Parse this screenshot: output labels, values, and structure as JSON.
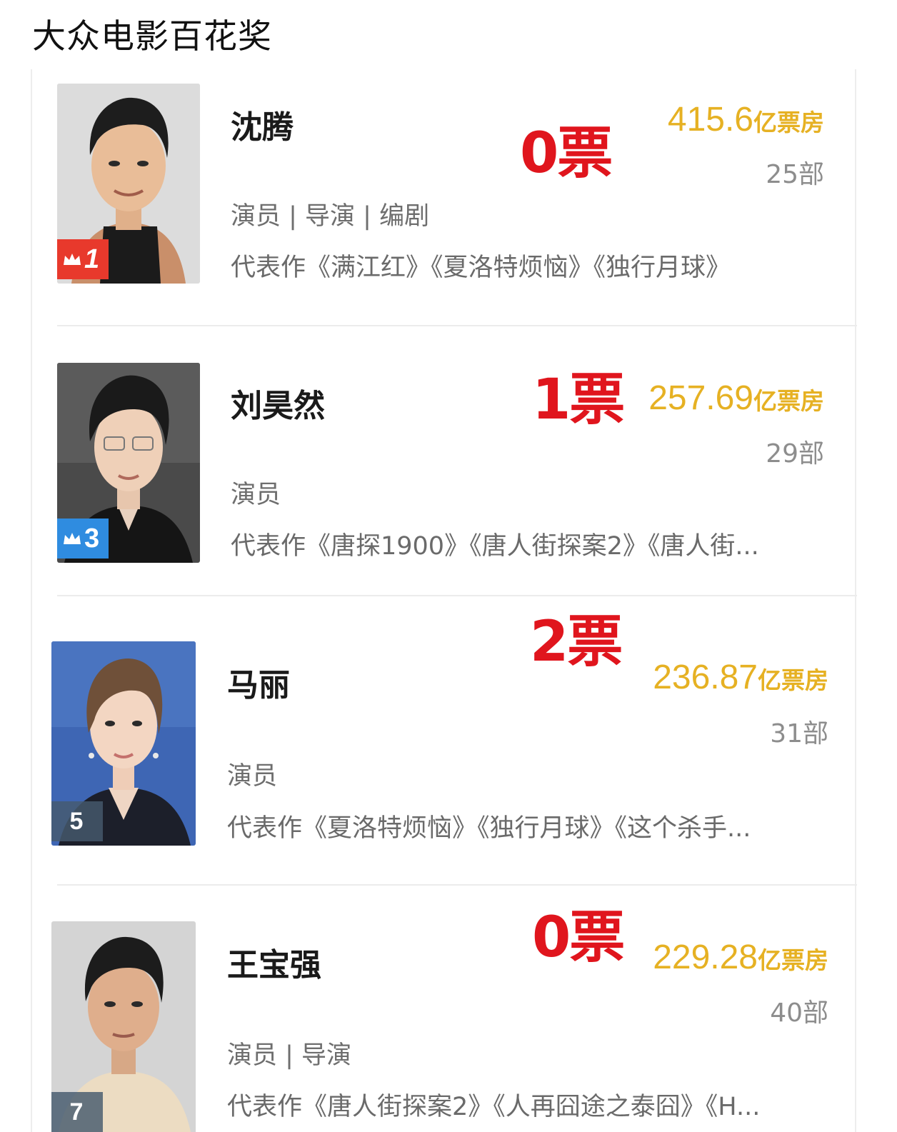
{
  "page": {
    "title": "大众电影百花奖"
  },
  "colors": {
    "votes_red": "#e0151d",
    "boxoffice_gold": "#e6b123",
    "rank_gold_badge": "#e8392c",
    "rank_blue_badge": "#2f8ce0",
    "rank_gray_badge": "#465a6e"
  },
  "nominees": [
    {
      "name": "沈腾",
      "rank": "1",
      "votes": "0票",
      "boxoffice_value": "415.6",
      "boxoffice_unit": "亿票房",
      "films": "25部",
      "roles": "演员 | 导演 | 编剧",
      "works": "代表作《满江红》《夏洛特烦恼》《独行月球》"
    },
    {
      "name": "刘昊然",
      "rank": "3",
      "votes": "1票",
      "boxoffice_value": "257.69",
      "boxoffice_unit": "亿票房",
      "films": "29部",
      "roles": "演员",
      "works": "代表作《唐探1900》《唐人街探案2》《唐人街..."
    },
    {
      "name": "马丽",
      "rank": "5",
      "votes": "2票",
      "boxoffice_value": "236.87",
      "boxoffice_unit": "亿票房",
      "films": "31部",
      "roles": "演员",
      "works": "代表作《夏洛特烦恼》《独行月球》《这个杀手..."
    },
    {
      "name": "王宝强",
      "rank": "7",
      "votes": "0票",
      "boxoffice_value": "229.28",
      "boxoffice_unit": "亿票房",
      "films": "40部",
      "roles": "演员 | 导演",
      "works": "代表作《唐人街探案2》《人再囧途之泰囧》《H..."
    }
  ]
}
